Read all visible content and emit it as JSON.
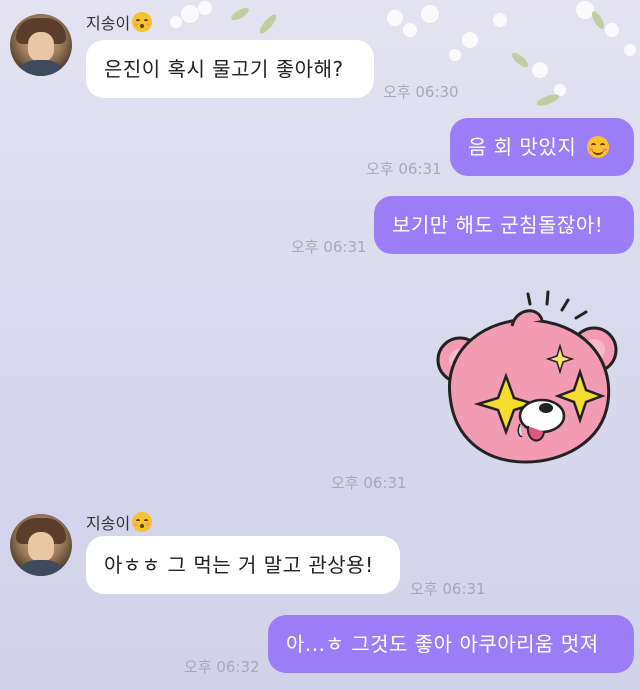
{
  "chat": {
    "sender_name": "지송이",
    "sender_emoji": "kissing-closed-eyes-emoji",
    "messages": [
      {
        "id": "m1",
        "side": "incoming",
        "text": "은진이 혹시 물고기 좋아해?",
        "time": "오후 06:30"
      },
      {
        "id": "m2",
        "side": "outgoing",
        "text": "음 회 맛있지",
        "emoji": "smiling-face-emoji",
        "time": "오후 06:31"
      },
      {
        "id": "m3",
        "side": "outgoing",
        "text": "보기만 해도 군침돌잖아!",
        "time": "오후 06:31"
      },
      {
        "id": "m4",
        "side": "outgoing",
        "sticker": "pink-bear-sparkle-eyes-sticker",
        "time": "오후 06:31"
      },
      {
        "id": "m5",
        "side": "incoming",
        "text": "아ㅎㅎ 그 먹는 거 말고 관상용!",
        "time": "오후 06:31"
      },
      {
        "id": "m6",
        "side": "outgoing",
        "text": "아...ㅎ 그것도 좋아 아쿠아리움 멋져",
        "time": "오후 06:32"
      }
    ]
  },
  "colors": {
    "outgoing_bubble": "#9b7ef7",
    "incoming_bubble": "#ffffff",
    "background": "#dcdcef",
    "timestamp": "#a9a8b8"
  }
}
